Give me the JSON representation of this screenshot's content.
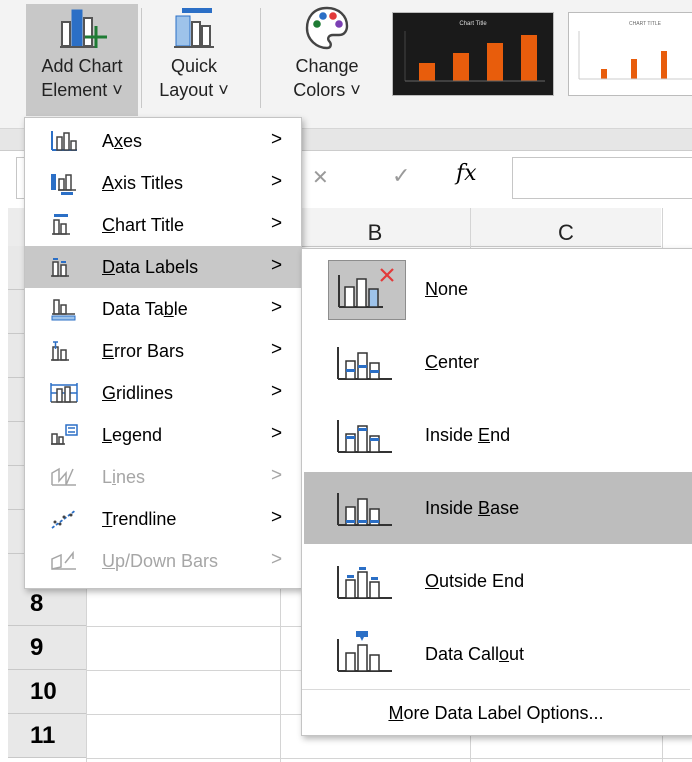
{
  "ribbon": {
    "add_chart_element": {
      "line1": "Add Chart",
      "line2": "Element ˅"
    },
    "quick_layout": {
      "line1": "Quick",
      "line2": "Layout ˅"
    },
    "change_colors": {
      "line1": "Change",
      "line2": "Colors ˅"
    },
    "style_thumb_1_title": "Chart Title",
    "style_thumb_2_title": "CHART TITLE"
  },
  "formula_bar": {
    "cancel": "✕",
    "enter": "✓",
    "fx": "fx",
    "value": ""
  },
  "columns": [
    "B",
    "C"
  ],
  "rows": [
    "8",
    "9",
    "10",
    "11"
  ],
  "menu": {
    "items": [
      {
        "pre": "A",
        "ul": "x",
        "post": "es",
        "icon": "axes-icon",
        "enabled": true
      },
      {
        "pre": "",
        "ul": "A",
        "post": "xis Titles",
        "icon": "axis-titles-icon",
        "enabled": true
      },
      {
        "pre": "",
        "ul": "C",
        "post": "hart Title",
        "icon": "chart-title-icon",
        "enabled": true
      },
      {
        "pre": "",
        "ul": "D",
        "post": "ata Labels",
        "icon": "data-labels-icon",
        "enabled": true
      },
      {
        "pre": "Data Ta",
        "ul": "b",
        "post": "le",
        "icon": "data-table-icon",
        "enabled": true
      },
      {
        "pre": "",
        "ul": "E",
        "post": "rror Bars",
        "icon": "error-bars-icon",
        "enabled": true
      },
      {
        "pre": "",
        "ul": "G",
        "post": "ridlines",
        "icon": "gridlines-icon",
        "enabled": true
      },
      {
        "pre": "",
        "ul": "L",
        "post": "egend",
        "icon": "legend-icon",
        "enabled": true
      },
      {
        "pre": "L",
        "ul": "i",
        "post": "nes",
        "icon": "lines-icon",
        "enabled": false
      },
      {
        "pre": "",
        "ul": "T",
        "post": "rendline",
        "icon": "trendline-icon",
        "enabled": true
      },
      {
        "pre": "",
        "ul": "U",
        "post": "p/Down Bars",
        "icon": "up-down-bars-icon",
        "enabled": false
      }
    ],
    "arrow": ">",
    "active_index": 3
  },
  "submenu": {
    "items": [
      {
        "pre": "",
        "ul": "N",
        "post": "one",
        "icon": "data-labels-none-icon"
      },
      {
        "pre": "",
        "ul": "C",
        "post": "enter",
        "icon": "data-labels-center-icon"
      },
      {
        "pre": "Inside ",
        "ul": "E",
        "post": "nd",
        "icon": "data-labels-inside-end-icon"
      },
      {
        "pre": "Inside ",
        "ul": "B",
        "post": "ase",
        "icon": "data-labels-inside-base-icon"
      },
      {
        "pre": "",
        "ul": "O",
        "post": "utside End",
        "icon": "data-labels-outside-end-icon"
      },
      {
        "pre": "Data Call",
        "ul": "o",
        "post": "ut",
        "icon": "data-callout-icon"
      }
    ],
    "hover_index": 3,
    "selected_index": 0,
    "more": {
      "pre": "",
      "ul": "M",
      "post": "ore Data Label Options..."
    }
  },
  "colors": {
    "accent_green": "#1e7b34",
    "accent_blue": "#2b6fc6",
    "bar_orange": "#e85d0c",
    "close_red": "#e23a3a"
  }
}
